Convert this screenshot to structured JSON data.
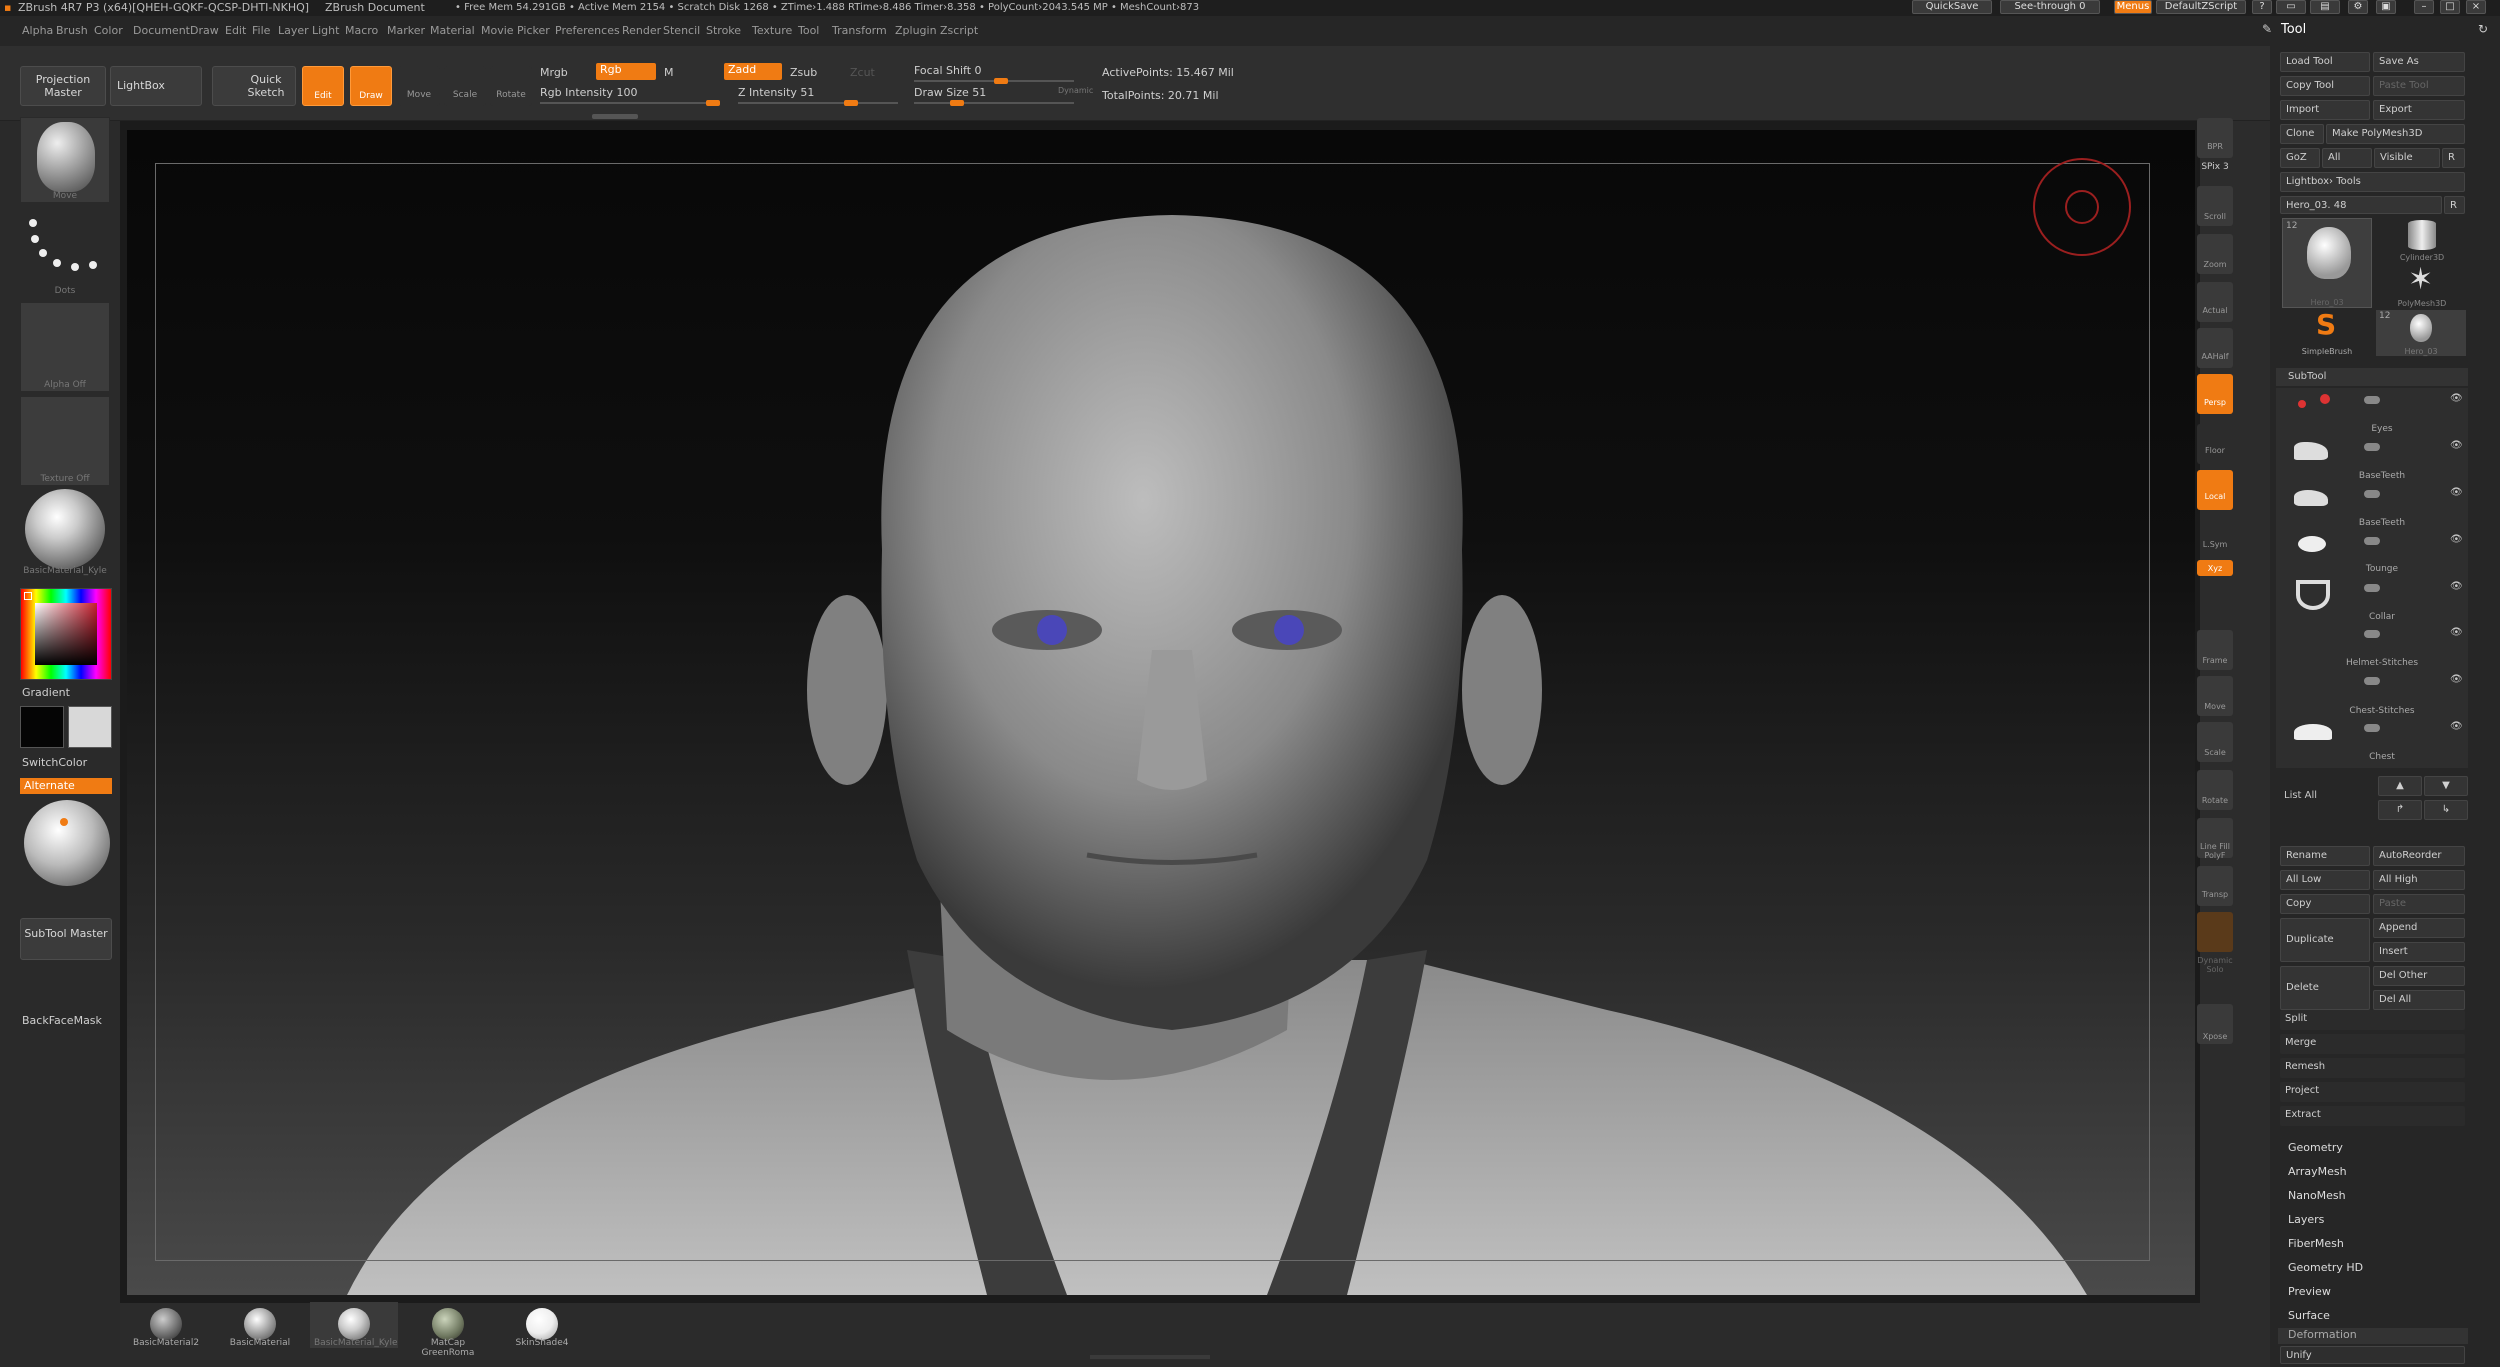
{
  "titlebar": {
    "app": "ZBrush 4R7 P3 (x64)[QHEH-GQKF-QCSP-DHTI-NKHQ]",
    "doc": "ZBrush Document",
    "stats": "• Free Mem 54.291GB • Active Mem 2154 • Scratch Disk 1268 • ZTime›1.488 RTime›8.486 Timer›8.358 • PolyCount›2043.545 MP • MeshCount›873",
    "quicksave": "QuickSave",
    "seethrough": "See-through  0",
    "menus": "Menus",
    "script": "DefaultZScript"
  },
  "menubar": [
    "Alpha",
    "Brush",
    "Color",
    "Document",
    "Draw",
    "Edit",
    "File",
    "Layer",
    "Light",
    "Macro",
    "Marker",
    "Material",
    "Movie",
    "Picker",
    "Preferences",
    "Render",
    "Stencil",
    "Stroke",
    "Texture",
    "Tool",
    "Transform",
    "Zplugin",
    "Zscript"
  ],
  "toolbar": {
    "projection": "Projection Master",
    "lightbox": "LightBox",
    "quicksketch": "Quick Sketch",
    "edit": "Edit",
    "draw": "Draw",
    "move": "Move",
    "scale": "Scale",
    "rotate": "Rotate",
    "mrgb": "Mrgb",
    "rgb": "Rgb",
    "m": "M",
    "zadd": "Zadd",
    "zsub": "Zsub",
    "zcut": "Zcut",
    "rgb_int": "Rgb  Intensity 100",
    "z_int": "Z Intensity 51",
    "focal": "Focal Shift 0",
    "drawsize": "Draw Size 51",
    "dynamic": "Dynamic",
    "active": "ActivePoints: 15.467  Mil",
    "total": "TotalPoints: 20.71  Mil"
  },
  "leftshelf": {
    "brush": "Move",
    "stroke": "Dots",
    "alpha": "Alpha  Off",
    "texture": "Texture  Off",
    "material": "BasicMaterial_Kyle",
    "gradient": "Gradient",
    "switchcolor": "SwitchColor",
    "alternate": "Alternate",
    "subtoolmaster": "SubTool Master",
    "backface": "BackFaceMask"
  },
  "rightshelf": [
    "BPR",
    "SPix 3",
    "Scroll",
    "Zoom",
    "Actual",
    "AAHalf",
    "Persp",
    "Floor",
    "Local",
    "L.Sym",
    "Xyz",
    "Frame",
    "Move",
    "Scale",
    "Rotate",
    "Line Fill PolyF",
    "Transp",
    "Ghost",
    "Dynamic Solo",
    "Xpose"
  ],
  "panel": {
    "title": "Tool",
    "load": "Load Tool",
    "saveas": "Save As",
    "copy": "Copy Tool",
    "paste": "Paste Tool",
    "import": "Import",
    "export": "Export",
    "clone": "Clone",
    "makepoly": "Make PolyMesh3D",
    "goz": "GoZ",
    "all": "All",
    "visible": "Visible",
    "r": "R",
    "lightbox": "Lightbox› Tools",
    "hero": "Hero_03. 48",
    "tools": [
      {
        "name": "Hero_03",
        "count": "12"
      },
      {
        "name": "Cylinder3D",
        "count": ""
      },
      {
        "name": "PolyMesh3D",
        "count": ""
      },
      {
        "name": "SimpleBrush",
        "count": ""
      },
      {
        "name": "Hero_03",
        "count": "12"
      }
    ],
    "subtool": "SubTool",
    "subtools": [
      "Eyes",
      "BaseTeeth",
      "BaseTeeth",
      "Tounge",
      "Collar",
      "Helmet-Stitches",
      "Chest-Stitches",
      "Chest"
    ],
    "listall": "List  All",
    "rename": "Rename",
    "autoreorder": "AutoReorder",
    "alllow": "All Low",
    "allhigh": "All High",
    "copy2": "Copy",
    "paste2": "Paste",
    "append": "Append",
    "duplicate": "Duplicate",
    "insert": "Insert",
    "delete": "Delete",
    "delother": "Del Other",
    "delall": "Del All",
    "split": "Split",
    "merge": "Merge",
    "remesh": "Remesh",
    "project": "Project",
    "extract": "Extract",
    "sections": [
      "Geometry",
      "ArrayMesh",
      "NanoMesh",
      "Layers",
      "FiberMesh",
      "Geometry HD",
      "Preview",
      "Surface",
      "Deformation"
    ],
    "unify": "Unify"
  },
  "materials": [
    "BasicMaterial2",
    "BasicMaterial",
    "BasicMaterial_Kyle",
    "MatCap  GreenRoma",
    "SkinShade4"
  ],
  "colors": {
    "accent": "#f07b13",
    "bg": "#2b2b2b"
  }
}
